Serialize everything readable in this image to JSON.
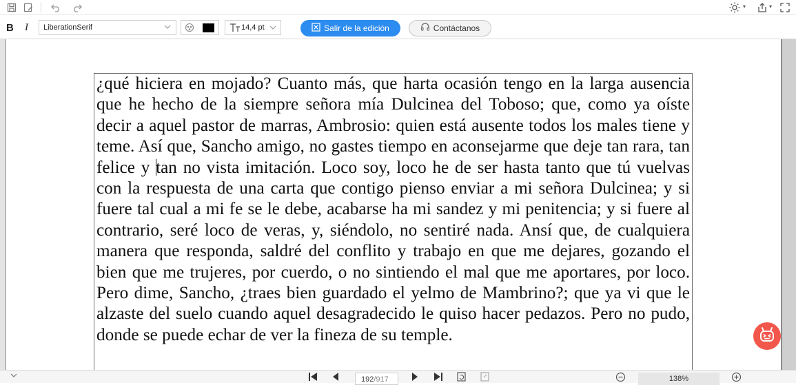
{
  "toolbar_top": {
    "icons": [
      "save-icon",
      "save-as-icon",
      "undo-icon",
      "redo-icon",
      "brightness-icon",
      "share-icon",
      "fullscreen-icon"
    ]
  },
  "format_bar": {
    "bold_label": "B",
    "italic_label": "I",
    "font_family": "LiberationSerif",
    "text_color": "#000000",
    "font_size": "14,4 pt",
    "exit_edit_label": "Salir de la edición",
    "contact_label": "Contáctanos",
    "accent_color": "#2d8cf0"
  },
  "document": {
    "text_before_caret": "¿qué hiciera en mojado? Cuanto más, que harta ocasión tengo en la larga ausencia que he hecho de la siempre señora mía Dulcinea del Toboso; que, como ya oíste decir a aquel pastor de marras, Ambrosio: quien está ausente todos los males tiene y teme. Así que, Sancho amigo, no gastes tiempo en aconsejarme que deje tan rara, tan felice y ",
    "text_after_caret": "tan no vista imitación. Loco soy, loco he de ser hasta tanto que tú vuelvas con la respuesta de una carta que contigo pienso enviar a mi señora Dulcinea; y si fuere tal cual a mi fe se le debe, acabarse ha mi sandez y mi penitencia; y si fuere al contrario, seré loco de veras, y, siéndolo, no sentiré nada. Ansí que, de cualquiera manera que responda, saldré del conflito y trabajo en que me dejares, gozando el bien que me trujeres, por cuerdo, o no sintiendo el mal que me aportares, por loco. Pero dime, Sancho, ¿traes bien guardado el yelmo de Mambrino?; que ya vi que le alzaste del suelo cuando aquel desagradecido le quiso hacer pedazos. Pero no pudo, donde se puede echar de ver la fineza de su temple."
  },
  "bottom_bar": {
    "current_page": "192",
    "total_pages": "/917",
    "zoom": "138%"
  },
  "fab": {
    "icon": "robot-assistant-icon",
    "color": "#f1574a"
  }
}
